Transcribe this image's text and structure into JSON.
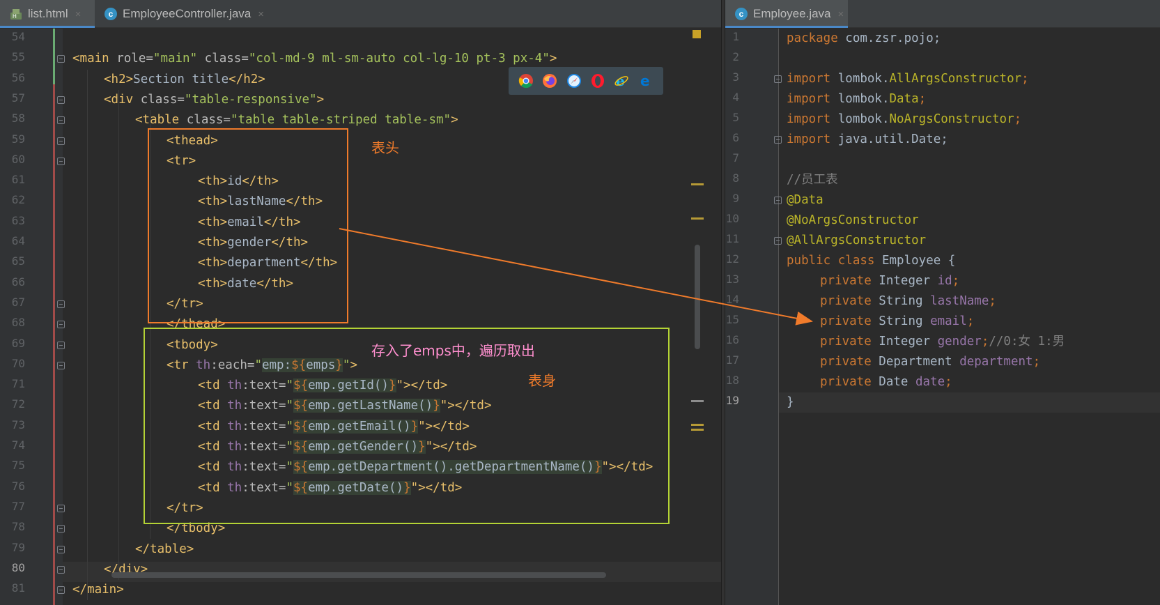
{
  "left_tabs": [
    {
      "label": "list.html",
      "close": "×"
    },
    {
      "label": "EmployeeController.java",
      "close": "×"
    }
  ],
  "right_tabs": [
    {
      "label": "Employee.java",
      "close": "×"
    }
  ],
  "left_lines": {
    "numbers": [
      "54",
      "55",
      "56",
      "57",
      "58",
      "59",
      "60",
      "61",
      "62",
      "63",
      "64",
      "65",
      "66",
      "67",
      "68",
      "69",
      "70",
      "71",
      "72",
      "73",
      "74",
      "75",
      "76",
      "77",
      "78",
      "79",
      "80",
      "81"
    ],
    "current": "80"
  },
  "html_code": {
    "l55a": "<main",
    "l55b": " role=",
    "l55c": "\"main\"",
    "l55d": " class=",
    "l55e": "\"col-md-9 ml-sm-auto col-lg-10 pt-3 px-4\"",
    "l55f": ">",
    "l56a": "<h2>",
    "l56b": "Section title",
    "l56c": "</h2>",
    "l57a": "<div",
    "l57b": " class=",
    "l57c": "\"table-responsive\"",
    "l57d": ">",
    "l58a": "<table",
    "l58b": " class=",
    "l58c": "\"table table-striped table-sm\"",
    "l58d": ">",
    "l59": "<thead>",
    "l60": "<tr>",
    "l61a": "<th>",
    "l61b": "id",
    "l61c": "</th>",
    "l62a": "<th>",
    "l62b": "lastName",
    "l62c": "</th>",
    "l63a": "<th>",
    "l63b": "email",
    "l63c": "</th>",
    "l64a": "<th>",
    "l64b": "gender",
    "l64c": "</th>",
    "l65a": "<th>",
    "l65b": "department",
    "l65c": "</th>",
    "l66a": "<th>",
    "l66b": "date",
    "l66c": "</th>",
    "l67": "</tr>",
    "l68": "</thead>",
    "l69": "<tbody>",
    "l70a": "<tr",
    "l70b": " th",
    "l70c": ":each=",
    "l70d": "\"",
    "l70e": "emp:",
    "l70f": "${",
    "l70g": "emps",
    "l70h": "}",
    "l70i": "\"",
    "l70j": ">",
    "td_open": "<td",
    "td_th": " th",
    "td_text": ":text=",
    "td_q": "\"",
    "td_dollar": "${",
    "td_close_brace": "}",
    "td_end": "\"></td>",
    "l71": "emp.getId()",
    "l72": "emp.getLastName()",
    "l73": "emp.getEmail()",
    "l74": "emp.getGender()",
    "l75": "emp.getDepartment().getDepartmentName()",
    "l76": "emp.getDate()",
    "l77": "</tr>",
    "l78": "</tbody>",
    "l79": "</table>",
    "l80": "</div>",
    "l81": "</main>"
  },
  "right_lines": {
    "numbers": [
      "1",
      "2",
      "3",
      "4",
      "5",
      "6",
      "7",
      "8",
      "9",
      "10",
      "11",
      "12",
      "13",
      "14",
      "15",
      "16",
      "17",
      "18",
      "19"
    ],
    "current": "19"
  },
  "java_code": {
    "r1a": "package",
    "r1b": " com.zsr.pojo;",
    "r3a": "import",
    "r3b": " lombok.",
    "r3c": "AllArgsConstructor",
    "r3d": ";",
    "r4a": "import",
    "r4b": " lombok.",
    "r4c": "Data",
    "r4d": ";",
    "r5a": "import",
    "r5b": " lombok.",
    "r5c": "NoArgsConstructor",
    "r5d": ";",
    "r6a": "import",
    "r6b": " java.util.Date;",
    "r8": "//员工表",
    "r9": "@Data",
    "r10": "@NoArgsConstructor",
    "r11": "@AllArgsConstructor",
    "r12a": "public class",
    "r12b": " Employee {",
    "priv": "private",
    "r13a": " Integer ",
    "r13b": "id",
    "r13c": ";",
    "r14a": " String ",
    "r14b": "lastName",
    "r14c": ";",
    "r15a": " String ",
    "r15b": "email",
    "r15c": ";",
    "r16a": " Integer ",
    "r16b": "gender",
    "r16c": ";",
    "r16d": "//0:女 1:男",
    "r17a": " Department ",
    "r17b": "department",
    "r17c": ";",
    "r18a": " Date ",
    "r18b": "date",
    "r18c": ";",
    "r19": "}"
  },
  "annotations": {
    "thead_label": "表头",
    "loop_label": "存入了emps中，遍历取出",
    "tbody_label": "表身",
    "thead_color": "#f07b2b",
    "tbody_color": "#b4d335",
    "arrow_color": "#f07b2b"
  },
  "browser_icons": [
    "chrome-icon",
    "firefox-icon",
    "safari-icon",
    "opera-icon",
    "ie-icon",
    "edge-icon"
  ]
}
